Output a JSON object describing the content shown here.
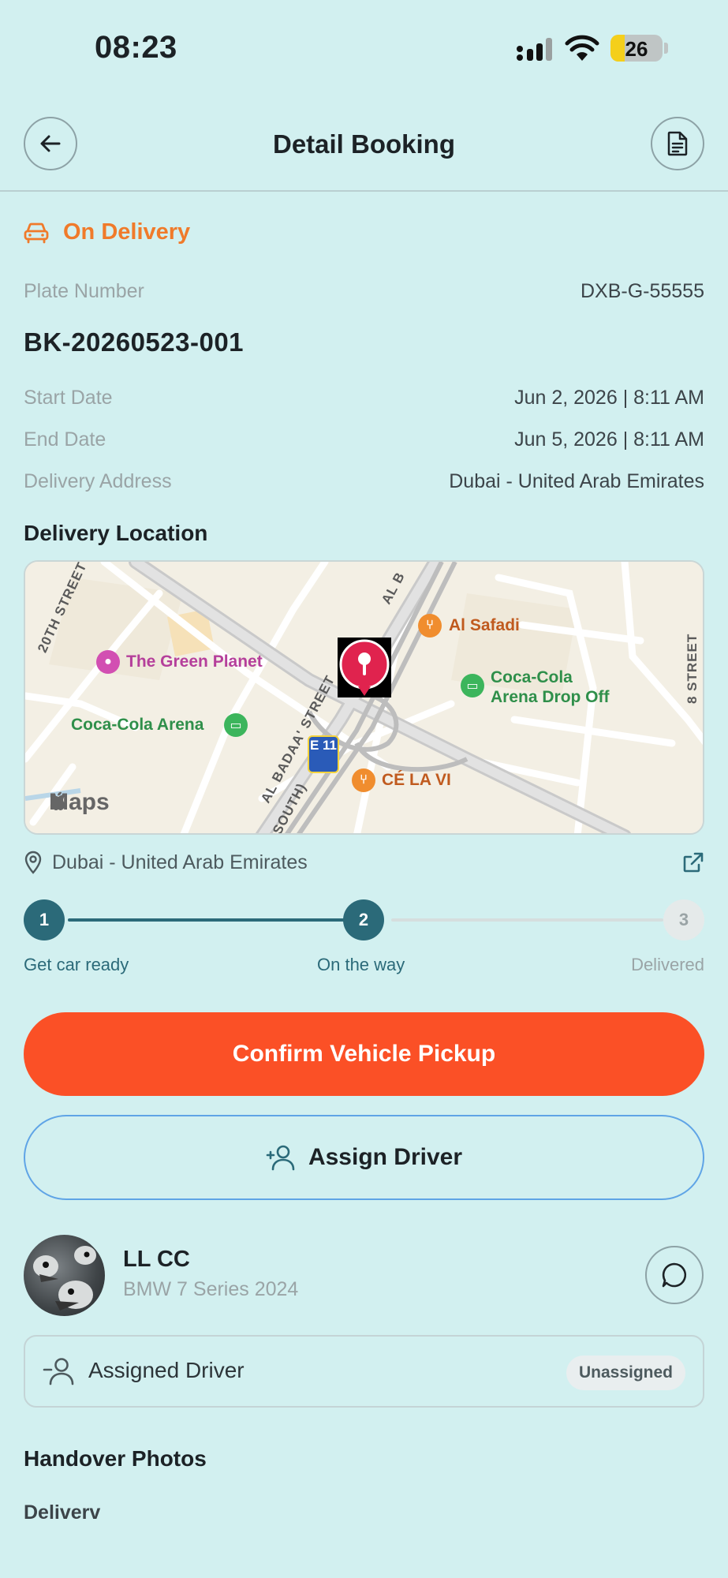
{
  "status_bar": {
    "time": "08:23",
    "battery": "26"
  },
  "header": {
    "title": "Detail Booking"
  },
  "booking": {
    "status": "On Delivery",
    "plate_label": "Plate Number",
    "plate_value": "DXB-G-55555",
    "booking_id": "BK-20260523-001",
    "start_label": "Start Date",
    "start_value": "Jun 2, 2026 | 8:11 AM",
    "end_label": "End Date",
    "end_value": "Jun 5, 2026 | 8:11 AM",
    "address_label": "Delivery Address",
    "address_value": "Dubai - United Arab Emirates"
  },
  "delivery_location": {
    "title": "Delivery Location",
    "address": "Dubai - United Arab Emirates",
    "map": {
      "poi_green_planet": "The Green Planet",
      "poi_al_safadi": "Al Safadi",
      "poi_coca_cola_arena": "Coca-Cola Arena",
      "poi_drop_off_line1": "Coca-Cola",
      "poi_drop_off_line2": "Arena Drop Off",
      "poi_ce_la_vi": "CÉ LA VI",
      "street_20th": "20TH STREET",
      "street_al_badaa": "AL BADAA' STREET",
      "street_8th": "8 STREET",
      "street_al_b": "AL B",
      "street_south": "SOUTH)",
      "shield_label": "E 11",
      "attribution": "Maps"
    }
  },
  "stepper": {
    "steps": [
      {
        "number": "1",
        "label": "Get car ready"
      },
      {
        "number": "2",
        "label": "On the way"
      },
      {
        "number": "3",
        "label": "Delivered"
      }
    ],
    "current_step": 2
  },
  "actions": {
    "confirm_label": "Confirm Vehicle Pickup",
    "assign_label": "Assign Driver"
  },
  "customer": {
    "name": "LL CC",
    "car": "BMW 7 Series 2024"
  },
  "assigned_driver": {
    "label": "Assigned Driver",
    "status": "Unassigned"
  },
  "handover": {
    "title": "Handover Photos",
    "subtitle": "Deliverv"
  },
  "colors": {
    "background": "#d2f0f0",
    "status_orange": "#f07a2a",
    "primary_button": "#fb5026",
    "step_active": "#2b6a79",
    "outline_blue": "#5fa4e6"
  }
}
